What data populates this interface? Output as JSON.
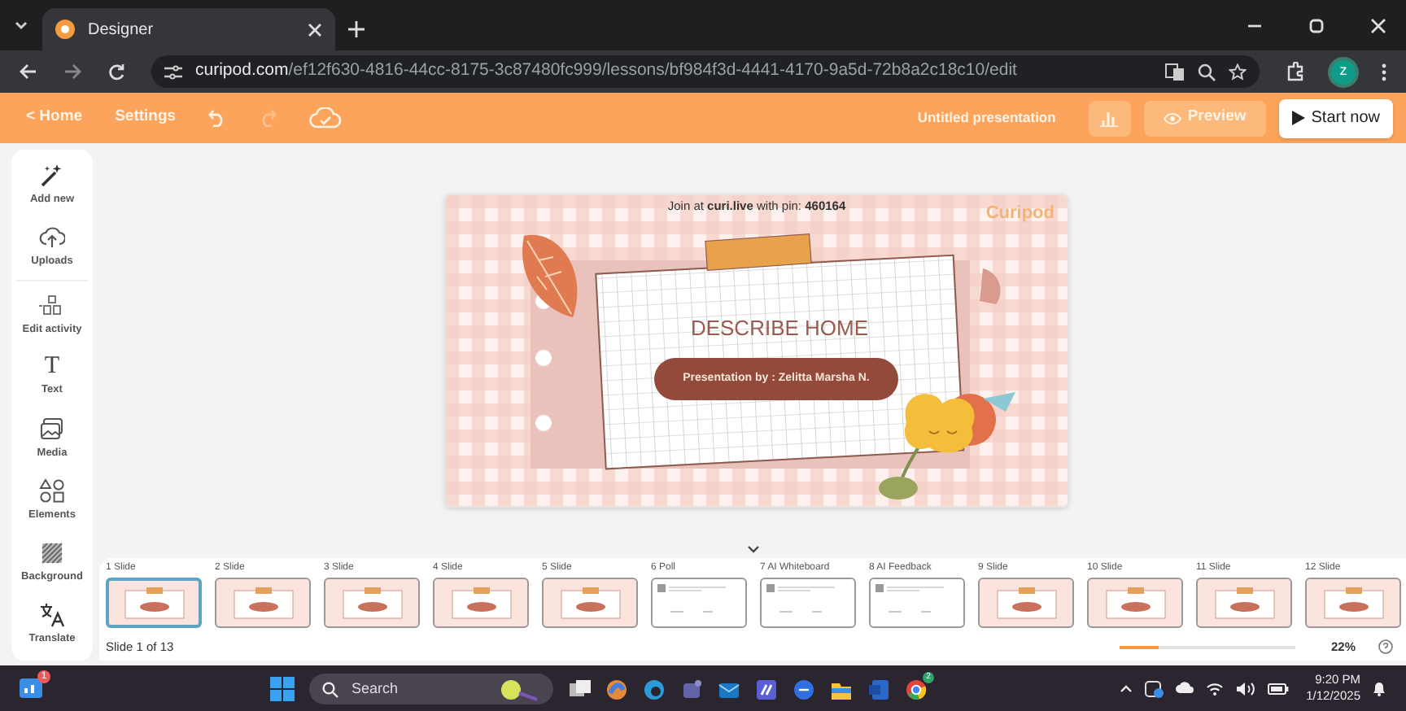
{
  "browser": {
    "tab_title": "Designer",
    "url_host": "curipod.com",
    "url_path": "/ef12f630-4816-44cc-8175-3c87480fc999/lessons/bf984f3d-4441-4170-9a5d-72b8a2c18c10/edit",
    "profile_initial": "z"
  },
  "toolbar": {
    "home": "< Home",
    "settings": "Settings",
    "presentation_title": "Untitled presentation",
    "preview": "Preview",
    "start": "Start now"
  },
  "sidebar": {
    "items": [
      {
        "kind": "wand",
        "label": "Add new"
      },
      {
        "kind": "upload",
        "label": "Uploads"
      },
      {
        "kind": "activity",
        "label": "Edit activity"
      },
      {
        "kind": "text",
        "label": "Text",
        "glyph": "T"
      },
      {
        "kind": "media",
        "label": "Media"
      },
      {
        "kind": "elements",
        "label": "Elements"
      },
      {
        "kind": "background",
        "label": "Background"
      },
      {
        "kind": "translate",
        "label": "Translate"
      }
    ]
  },
  "slide": {
    "join_text": "Join at **curi.live** with pin: **460164**",
    "brand": "Curipod",
    "title": "DESCRIBE HOME",
    "subtitle": "Presentation by : Zelitta Marsha N."
  },
  "thumbnails": [
    {
      "label": "1 Slide",
      "kind": "design",
      "selected": true
    },
    {
      "label": "2 Slide",
      "kind": "design",
      "selected": false
    },
    {
      "label": "3 Slide",
      "kind": "design",
      "selected": false
    },
    {
      "label": "4 Slide",
      "kind": "design",
      "selected": false
    },
    {
      "label": "5 Slide",
      "kind": "design",
      "selected": false
    },
    {
      "label": "6 Poll",
      "kind": "activity",
      "selected": false
    },
    {
      "label": "7 AI Whiteboard",
      "kind": "activity",
      "selected": false
    },
    {
      "label": "8 AI Feedback",
      "kind": "activity",
      "selected": false
    },
    {
      "label": "9 Slide",
      "kind": "design",
      "selected": false
    },
    {
      "label": "10 Slide",
      "kind": "design",
      "selected": false
    },
    {
      "label": "11 Slide",
      "kind": "design",
      "selected": false
    },
    {
      "label": "12 Slide",
      "kind": "design",
      "selected": false
    }
  ],
  "slide_counter": "Slide 1 of 13",
  "zoom": {
    "level": 0.22,
    "reading": "22%"
  },
  "taskbar": {
    "widgets_badge": "1",
    "search_placeholder": "Search",
    "chrome_badge": "2",
    "time": "9:20 PM",
    "date": "1/12/2025"
  }
}
